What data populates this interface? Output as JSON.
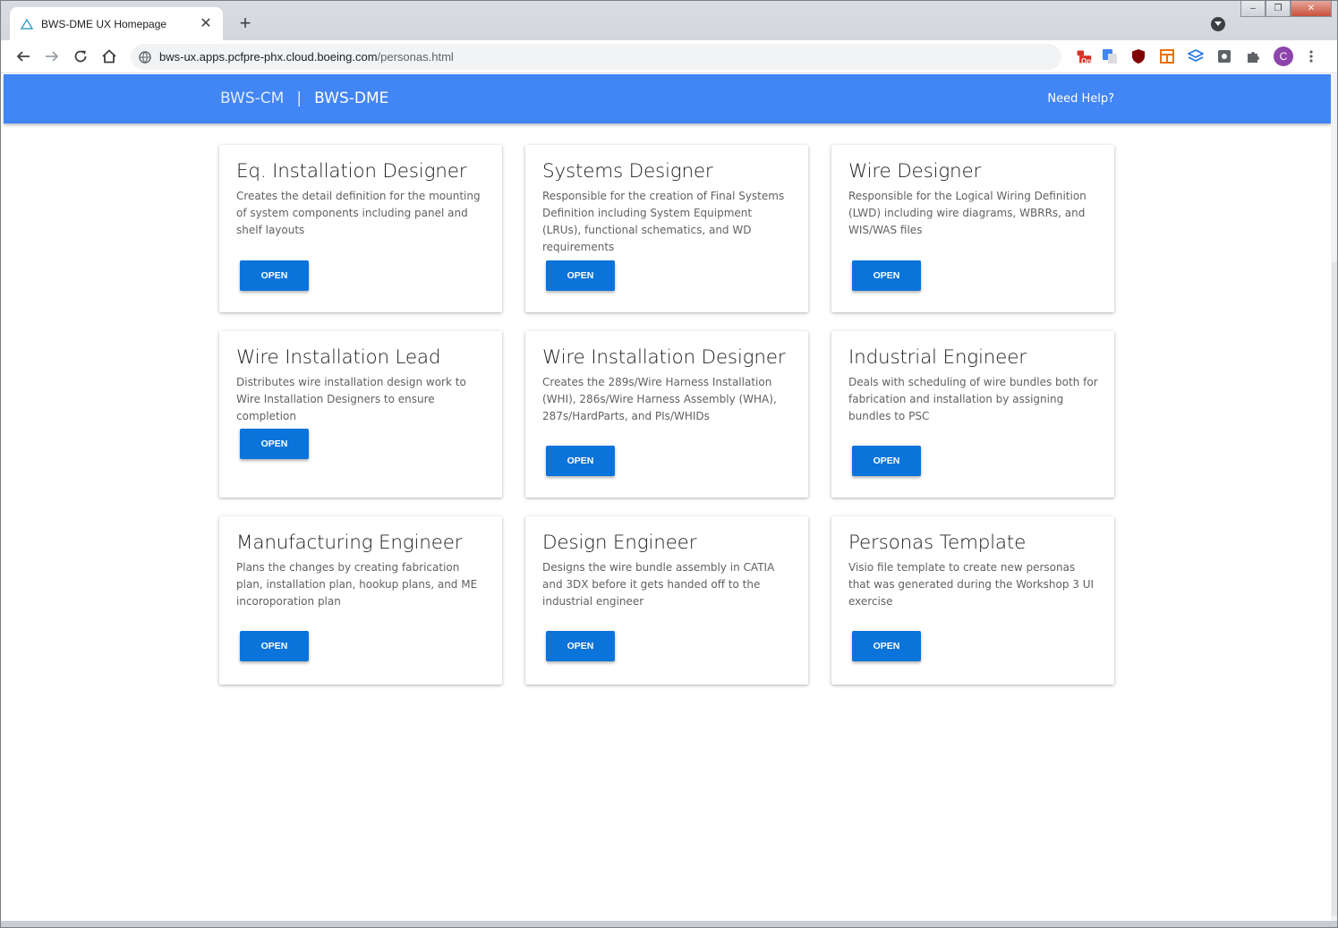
{
  "browser": {
    "tab_title": "BWS-DME UX Homepage",
    "tab_close": "✕",
    "new_tab": "+",
    "url_host": "bws-ux.apps.pcfpre-phx.cloud.boeing.com",
    "url_path": "/personas.html",
    "window_minimize": "‒",
    "window_maximize": "❐",
    "window_close": "✕",
    "extension_badge": "On",
    "profile_initial": "C"
  },
  "header": {
    "brand_primary": "BWS-CM",
    "separator": "|",
    "brand_secondary": "BWS-DME",
    "help_link": "Need Help?"
  },
  "colors": {
    "appbar": "#4285f4",
    "button": "#0a74da"
  },
  "personas": [
    {
      "title": "Eq. Installation Designer",
      "description": "Creates the detail definition for the mounting of system components including panel and shelf layouts",
      "button": "OPEN"
    },
    {
      "title": "Systems Designer",
      "description": "Responsible for the creation of Final Systems Definition including System Equipment (LRUs), functional schematics, and WD requirements",
      "button": "OPEN"
    },
    {
      "title": "Wire Designer",
      "description": "Responsible for the Logical Wiring Definition (LWD) including wire diagrams, WBRRs, and WIS/WAS files",
      "button": "OPEN"
    },
    {
      "title": "Wire Installation Lead",
      "description": "Distributes wire installation design work to Wire Installation Designers to ensure completion",
      "button": "OPEN"
    },
    {
      "title": "Wire Installation Designer",
      "description": "Creates the 289s/Wire Harness Installation (WHI), 286s/Wire Harness Assembly (WHA), 287s/HardParts, and PIs/WHIDs",
      "button": "OPEN"
    },
    {
      "title": "Industrial Engineer",
      "description": "Deals with scheduling of wire bundles both for fabrication and installation by assigning bundles to PSC",
      "button": "OPEN"
    },
    {
      "title": "Manufacturing Engineer",
      "description": "Plans the changes by creating fabrication plan, installation plan, hookup plans, and ME incoroporation plan",
      "button": "OPEN"
    },
    {
      "title": "Design Engineer",
      "description": "Designs the wire bundle assembly in CATIA and 3DX before it gets handed off to the industrial engineer",
      "button": "OPEN"
    },
    {
      "title": "Personas Template",
      "description": "Visio file template to create new personas that was generated during the Workshop 3 UI exercise",
      "button": "OPEN"
    }
  ]
}
